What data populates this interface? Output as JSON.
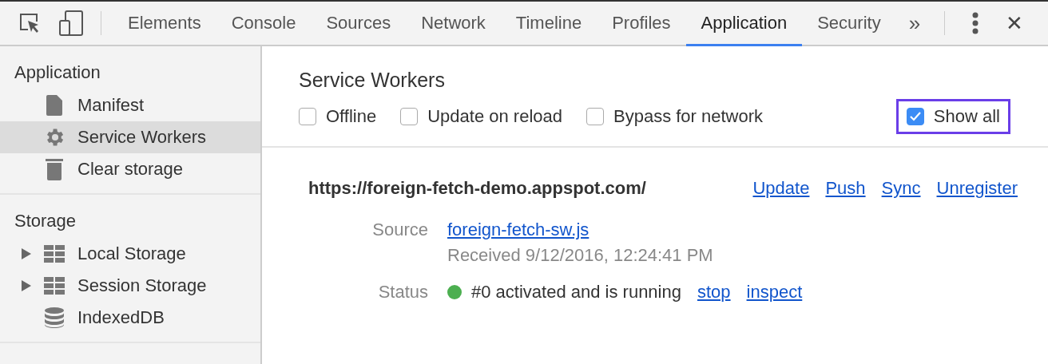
{
  "toolbar": {
    "tabs": [
      {
        "label": "Elements",
        "selected": false
      },
      {
        "label": "Console",
        "selected": false
      },
      {
        "label": "Sources",
        "selected": false
      },
      {
        "label": "Network",
        "selected": false
      },
      {
        "label": "Timeline",
        "selected": false
      },
      {
        "label": "Profiles",
        "selected": false
      },
      {
        "label": "Application",
        "selected": true
      },
      {
        "label": "Security",
        "selected": false
      }
    ],
    "overflow": "»",
    "close": "✕"
  },
  "sidebar": {
    "sections": [
      {
        "title": "Application",
        "items": [
          {
            "label": "Manifest",
            "kind": "file",
            "selected": false
          },
          {
            "label": "Service Workers",
            "kind": "gear",
            "selected": true
          },
          {
            "label": "Clear storage",
            "kind": "trash",
            "selected": false
          }
        ]
      },
      {
        "title": "Storage",
        "items": [
          {
            "label": "Local Storage",
            "kind": "grid",
            "selected": false,
            "expanded": false
          },
          {
            "label": "Session Storage",
            "kind": "grid",
            "selected": false,
            "expanded": false
          },
          {
            "label": "IndexedDB",
            "kind": "database",
            "selected": false
          }
        ]
      }
    ]
  },
  "panel": {
    "title": "Service Workers",
    "options": [
      {
        "label": "Offline",
        "checked": false,
        "highlighted": false
      },
      {
        "label": "Update on reload",
        "checked": false,
        "highlighted": false
      },
      {
        "label": "Bypass for network",
        "checked": false,
        "highlighted": false
      },
      {
        "label": "Show all",
        "checked": true,
        "highlighted": true
      }
    ],
    "worker": {
      "scope": "https://foreign-fetch-demo.appspot.com/",
      "actions": [
        "Update",
        "Push",
        "Sync",
        "Unregister"
      ],
      "source_label": "Source",
      "source_link": "foreign-fetch-sw.js",
      "received": "Received 9/12/2016, 12:24:41 PM",
      "status_label": "Status",
      "running": true,
      "status_text": "#0 activated and is running",
      "status_actions": [
        "stop",
        "inspect"
      ]
    }
  }
}
